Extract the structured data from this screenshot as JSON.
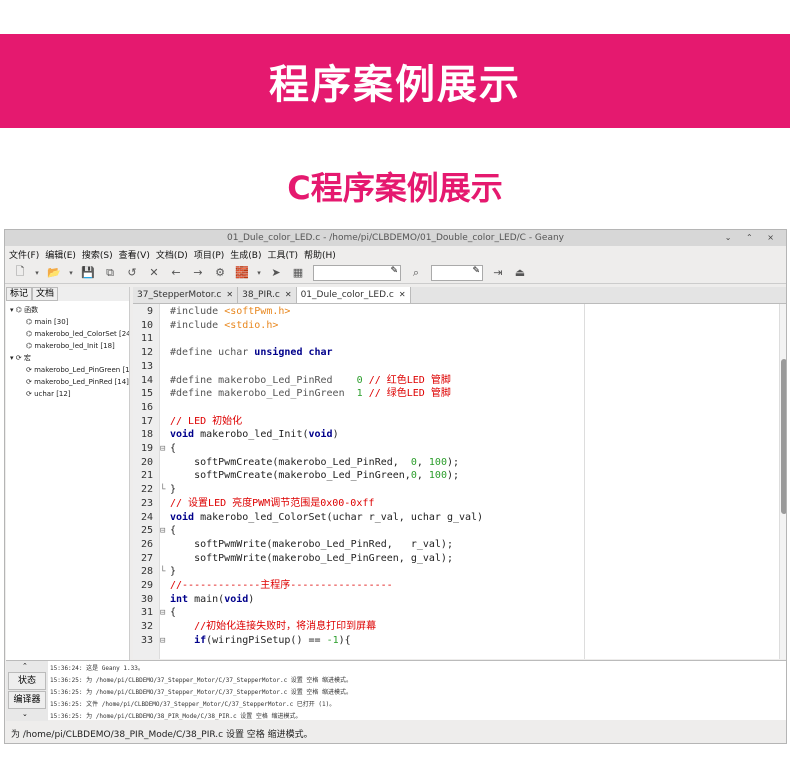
{
  "banner_title": "程序案例展示",
  "subtitle": "C程序案例展示",
  "window": {
    "title": "01_Dule_color_LED.c - /home/pi/CLBDEMO/01_Double_color_LED/C - Geany",
    "controls": "⌄ ⌃ ×"
  },
  "menu": [
    "文件(F)",
    "编辑(E)",
    "搜索(S)",
    "查看(V)",
    "文档(D)",
    "项目(P)",
    "生成(B)",
    "工具(T)",
    "帮助(H)"
  ],
  "sidebar": {
    "tabs": [
      "标记",
      "文档"
    ],
    "tree": [
      {
        "indent": 0,
        "text": "▾ ⌬ 函数"
      },
      {
        "indent": 1,
        "text": "⌬ main [30]"
      },
      {
        "indent": 1,
        "text": "⌬ makerobo_led_ColorSet [24]"
      },
      {
        "indent": 1,
        "text": "⌬ makerobo_led_Init [18]"
      },
      {
        "indent": 0,
        "text": "▾ ⟳ 宏"
      },
      {
        "indent": 1,
        "text": "⟳ makerobo_Led_PinGreen [15]"
      },
      {
        "indent": 1,
        "text": "⟳ makerobo_Led_PinRed [14]"
      },
      {
        "indent": 1,
        "text": "⟳ uchar [12]"
      }
    ]
  },
  "editor_tabs": [
    {
      "label": "37_StepperMotor.c",
      "close": "✕",
      "active": false
    },
    {
      "label": "38_PIR.c",
      "close": "✕",
      "active": false
    },
    {
      "label": "01_Dule_color_LED.c",
      "close": "✕",
      "active": true
    }
  ],
  "code_lines": [
    {
      "n": "9",
      "f": "",
      "html": "<span style='color:#555'>#include </span><span style='color:#e8871e'>&lt;softPwm.h&gt;</span>"
    },
    {
      "n": "10",
      "f": "",
      "html": "<span style='color:#555'>#include </span><span style='color:#e8871e'>&lt;stdio.h&gt;</span>"
    },
    {
      "n": "11",
      "f": "",
      "html": ""
    },
    {
      "n": "12",
      "f": "",
      "html": "<span style='color:#555'>#define uchar </span><span style='color:#00008b;font-weight:bold'>unsigned char</span>"
    },
    {
      "n": "13",
      "f": "",
      "html": ""
    },
    {
      "n": "14",
      "f": "",
      "html": "<span style='color:#555'>#define makerobo_Led_PinRed    </span><span style='color:#2a9d2a'>0</span><span style='color:#d00'> // 红色LED 管脚</span>"
    },
    {
      "n": "15",
      "f": "",
      "html": "<span style='color:#555'>#define makerobo_Led_PinGreen  </span><span style='color:#2a9d2a'>1</span><span style='color:#d00'> // 绿色LED 管脚</span>"
    },
    {
      "n": "16",
      "f": "",
      "html": ""
    },
    {
      "n": "17",
      "f": "",
      "html": "<span style='color:#d00'>// LED 初始化</span>"
    },
    {
      "n": "18",
      "f": "",
      "html": "<span style='color:#00008b;font-weight:bold'>void</span> makerobo_led_Init(<span style='color:#00008b;font-weight:bold'>void</span>)"
    },
    {
      "n": "19",
      "f": "⊟",
      "html": "{"
    },
    {
      "n": "20",
      "f": "",
      "html": "    softPwmCreate(makerobo_Led_PinRed,  <span style='color:#2a9d2a'>0</span>, <span style='color:#2a9d2a'>100</span>);"
    },
    {
      "n": "21",
      "f": "",
      "html": "    softPwmCreate(makerobo_Led_PinGreen,<span style='color:#2a9d2a'>0</span>, <span style='color:#2a9d2a'>100</span>);"
    },
    {
      "n": "22",
      "f": "└",
      "html": "}"
    },
    {
      "n": "23",
      "f": "",
      "html": "<span style='color:#d00'>// 设置LED 亮度PWM调节范围是0x00-0xff</span>"
    },
    {
      "n": "24",
      "f": "",
      "html": "<span style='color:#00008b;font-weight:bold'>void</span> makerobo_led_ColorSet(uchar r_val, uchar g_val)"
    },
    {
      "n": "25",
      "f": "⊟",
      "html": "{"
    },
    {
      "n": "26",
      "f": "",
      "html": "    softPwmWrite(makerobo_Led_PinRed,   r_val);"
    },
    {
      "n": "27",
      "f": "",
      "html": "    softPwmWrite(makerobo_Led_PinGreen, g_val);"
    },
    {
      "n": "28",
      "f": "└",
      "html": "}"
    },
    {
      "n": "29",
      "f": "",
      "html": "<span style='color:#d00'>//-------------主程序-----------------</span>"
    },
    {
      "n": "30",
      "f": "",
      "html": "<span style='color:#00008b;font-weight:bold'>int</span> main(<span style='color:#00008b;font-weight:bold'>void</span>)"
    },
    {
      "n": "31",
      "f": "⊟",
      "html": "{"
    },
    {
      "n": "32",
      "f": "",
      "html": "    <span style='color:#d00'>//初始化连接失败时，将消息打印到屏幕</span>"
    },
    {
      "n": "33",
      "f": "⊟",
      "html": "    <span style='color:#00008b;font-weight:bold'>if</span>(wiringPiSetup() == <span style='color:#2a9d2a'>-1</span>){"
    }
  ],
  "messages": {
    "tabs": [
      "状态",
      "编译器"
    ],
    "lines": [
      "15:36:24: 这是 Geany 1.33。",
      "15:36:25: 为 /home/pi/CLBDEMO/37_Stepper_Motor/C/37_StepperMotor.c 设置 空格 缩进模式。",
      "15:36:25: 为 /home/pi/CLBDEMO/37_Stepper_Motor/C/37_StepperMotor.c 设置 空格 缩进模式。",
      "15:36:25: 文件 /home/pi/CLBDEMO/37_Stepper_Motor/C/37_StepperMotor.c 已打开 (1)。",
      "15:36:25: 为 /home/pi/CLBDEMO/38_PIR_Mode/C/38_PIR.c 设置 空格 缩进模式。"
    ]
  },
  "status_bar": "为 /home/pi/CLBDEMO/38_PIR_Mode/C/38_PIR.c 设置 空格 缩进模式。",
  "colors": {
    "accent": "#e5196f"
  }
}
